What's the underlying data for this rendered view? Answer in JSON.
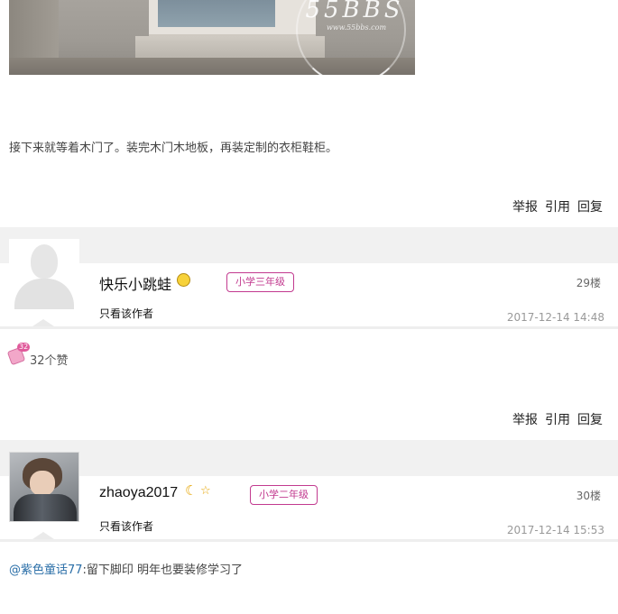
{
  "post": {
    "image_watermark": "55BBS",
    "image_watermark_url": "www.55bbs.com",
    "text": "接下来就等着木门了。装完木门木地板，再装定制的衣柜鞋柜。"
  },
  "actions": {
    "report": "举报",
    "quote": "引用",
    "reply": "回复"
  },
  "replies": [
    {
      "username": "快乐小跳蛙",
      "badge": "小学三年级",
      "floor": "29楼",
      "view_author": "只看该作者",
      "date": "2017-12-14 14:48",
      "likes_badge": "32",
      "likes_text": "32个赞",
      "icons": [
        "smiley-icon"
      ]
    },
    {
      "username": "zhaoya2017",
      "badge": "小学二年级",
      "floor": "30楼",
      "view_author": "只看该作者",
      "date": "2017-12-14 15:53",
      "comment_mention": "@紫色童话77",
      "comment_text": ":留下脚印 明年也要装修学习了",
      "icons": [
        "moon-icon",
        "star-icon"
      ]
    }
  ],
  "colors": {
    "badge": "#c23a8f",
    "mention": "#2b6fa8",
    "band": "#f1f1f1"
  }
}
